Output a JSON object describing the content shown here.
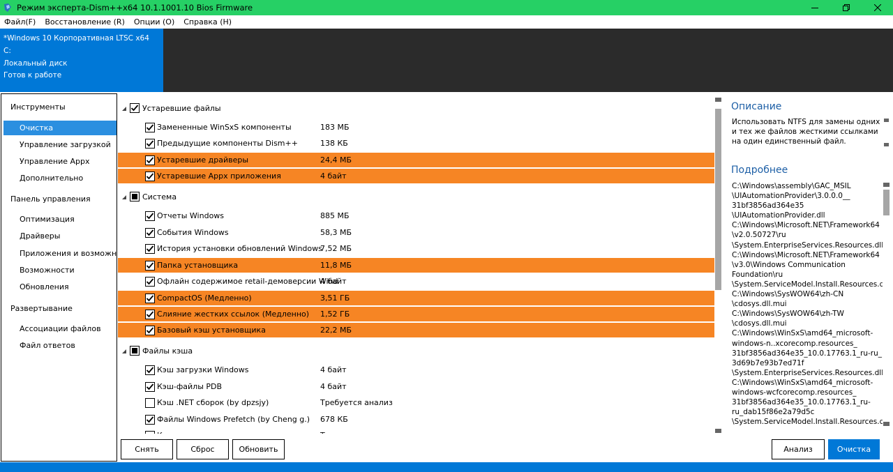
{
  "window": {
    "title": "Режим эксперта-Dism++x64 10.1.1001.10 Bios Firmware"
  },
  "menu": [
    "Файл(F)",
    "Восстановление (R)",
    "Опции (O)",
    "Справка (H)"
  ],
  "header": {
    "lines": [
      "*Windows 10 Корпоративная LTSC x64",
      "C:",
      "Локальный диск",
      "Готов к работе"
    ]
  },
  "sidebar": {
    "sections": [
      {
        "label": "Инструменты",
        "items": [
          "Очистка",
          "Управление загрузкой",
          "Управление Appx",
          "Дополнительно"
        ]
      },
      {
        "label": "Панель управления",
        "items": [
          "Оптимизация",
          "Драйверы",
          "Приложения и возможности",
          "Возможности",
          "Обновления"
        ]
      },
      {
        "label": "Развертывание",
        "items": [
          "Ассоциации файлов",
          "Файл ответов"
        ]
      }
    ],
    "selected": "Очистка"
  },
  "groups": [
    {
      "label": "Устаревшие файлы",
      "state": "checked",
      "rows": [
        {
          "name": "Замененные WinSxS компоненты",
          "size": "183 МБ",
          "checked": true,
          "highlight": false
        },
        {
          "name": "Предыдущие компоненты Dism++",
          "size": "138 КБ",
          "checked": true,
          "highlight": false
        },
        {
          "name": "Устаревшие драйверы",
          "size": "24,4 МБ",
          "checked": true,
          "highlight": true
        },
        {
          "name": "Устаревшие Appx приложения",
          "size": "4 байт",
          "checked": true,
          "highlight": true
        }
      ]
    },
    {
      "label": "Система",
      "state": "partial",
      "rows": [
        {
          "name": "Отчеты Windows",
          "size": "885 МБ",
          "checked": true,
          "highlight": false
        },
        {
          "name": "События Windows",
          "size": "58,3 МБ",
          "checked": true,
          "highlight": false
        },
        {
          "name": "История установки обновлений Windows",
          "size": "7,52 МБ",
          "checked": true,
          "highlight": false
        },
        {
          "name": "Папка установщика",
          "size": "11,8 МБ",
          "checked": true,
          "highlight": true
        },
        {
          "name": "Офлайн содержимое retail-демоверсии Wind",
          "size": "4 байт",
          "checked": true,
          "highlight": false
        },
        {
          "name": "CompactOS (Медленно)",
          "size": "3,51 ГБ",
          "checked": true,
          "highlight": true
        },
        {
          "name": "Слияние жестких ссылок (Медленно)",
          "size": "1,52 ГБ",
          "checked": true,
          "highlight": true
        },
        {
          "name": "Базовый кэш установщика",
          "size": "22,2 МБ",
          "checked": true,
          "highlight": true
        }
      ]
    },
    {
      "label": "Файлы кэша",
      "state": "partial",
      "rows": [
        {
          "name": "Кэш загрузки Windows",
          "size": "4 байт",
          "checked": true,
          "highlight": false
        },
        {
          "name": "Кэш-файлы PDB",
          "size": "4 байт",
          "checked": true,
          "highlight": false
        },
        {
          "name": "Кэш .NET сборок (by dpzsjy)",
          "size": "Требуется анализ",
          "checked": false,
          "highlight": false
        },
        {
          "name": "Файлы Windows Prefetch (by Cheng g.)",
          "size": "678 КБ",
          "checked": true,
          "highlight": false
        },
        {
          "name": "К",
          "size": "Т",
          "checked": false,
          "highlight": false
        }
      ]
    }
  ],
  "right_panel": {
    "description_header": "Описание",
    "description": "Использовать NTFS для замены одних и тех же файлов жесткими ссылками на один единственный файл.",
    "details_header": "Подробнее",
    "paths": [
      "C:\\Windows\\assembly\\GAC_MSIL",
      "\\UIAutomationProvider\\3.0.0.0__",
      "31bf3856ad364e35",
      "\\UIAutomationProvider.dll",
      "C:\\Windows\\Microsoft.NET\\Framework64",
      "\\v2.0.50727\\ru",
      "\\System.EnterpriseServices.Resources.dll",
      "C:\\Windows\\Microsoft.NET\\Framework64",
      "\\v3.0\\Windows Communication",
      "Foundation\\ru",
      "\\System.ServiceModel.Install.Resources.dll",
      "C:\\Windows\\SysWOW64\\zh-CN",
      "\\cdosys.dll.mui",
      "C:\\Windows\\SysWOW64\\zh-TW",
      "\\cdosys.dll.mui",
      "C:\\Windows\\WinSxS\\amd64_microsoft-",
      "windows-n..xcorecomp.resources_",
      "31bf3856ad364e35_10.0.17763.1_ru-ru_",
      "3d69b7e93b7ed71f",
      "\\System.EnterpriseServices.Resources.dll",
      "C:\\Windows\\WinSxS\\amd64_microsoft-",
      "windows-wcfcorecomp.resources_",
      "31bf3856ad364e35_10.0.17763.1_ru-",
      "ru_dab15f86e2a79d5c",
      "\\System.ServiceModel.Install.Resources.dll"
    ]
  },
  "buttons": {
    "uncheck": "Снять",
    "reset": "Сброс",
    "refresh": "Обновить",
    "analyze": "Анализ",
    "clean": "Очистка"
  },
  "colors": {
    "titlebar": "#26d065",
    "accent": "#0078d7",
    "highlight": "#f68524",
    "header_dark": "#2b2b2b"
  }
}
